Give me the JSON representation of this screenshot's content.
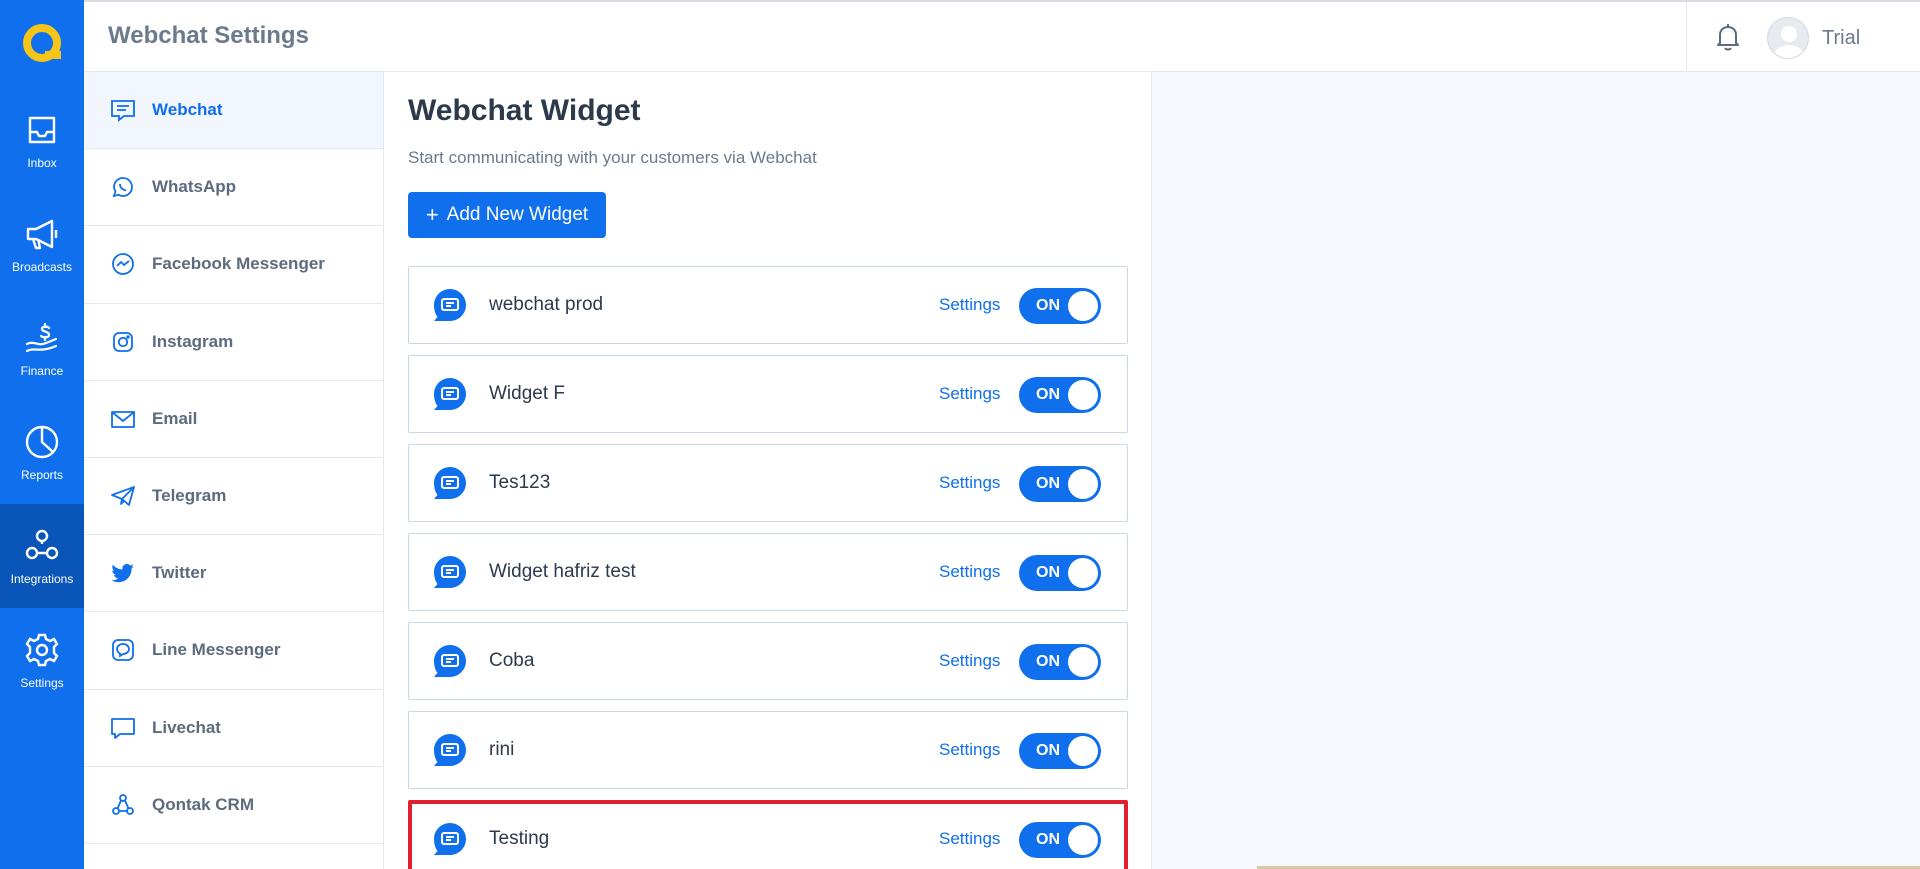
{
  "header": {
    "title": "Webchat Settings",
    "user_name": "Trial"
  },
  "rail": {
    "items": [
      {
        "label": "Inbox",
        "icon": "inbox-icon"
      },
      {
        "label": "Broadcasts",
        "icon": "megaphone-icon"
      },
      {
        "label": "Finance",
        "icon": "finance-icon"
      },
      {
        "label": "Reports",
        "icon": "pie-chart-icon"
      },
      {
        "label": "Integrations",
        "icon": "integrations-icon",
        "active": true
      },
      {
        "label": "Settings",
        "icon": "gear-icon"
      }
    ]
  },
  "subnav": {
    "items": [
      {
        "label": "Webchat",
        "icon": "webchat-icon",
        "active": true
      },
      {
        "label": "WhatsApp",
        "icon": "whatsapp-icon"
      },
      {
        "label": "Facebook Messenger",
        "icon": "messenger-icon"
      },
      {
        "label": "Instagram",
        "icon": "instagram-icon"
      },
      {
        "label": "Email",
        "icon": "email-icon"
      },
      {
        "label": "Telegram",
        "icon": "telegram-icon"
      },
      {
        "label": "Twitter",
        "icon": "twitter-icon"
      },
      {
        "label": "Line Messenger",
        "icon": "line-icon"
      },
      {
        "label": "Livechat",
        "icon": "livechat-icon"
      },
      {
        "label": "Qontak CRM",
        "icon": "crm-icon"
      }
    ]
  },
  "main": {
    "title": "Webchat Widget",
    "description": "Start communicating with your customers via Webchat",
    "add_button_label": "Add New Widget",
    "add_button_icon": "+",
    "settings_label": "Settings",
    "toggle_label": "ON",
    "widgets": [
      {
        "name": "webchat prod",
        "status": "ON"
      },
      {
        "name": "Widget F",
        "status": "ON"
      },
      {
        "name": "Tes123",
        "status": "ON"
      },
      {
        "name": "Widget hafriz test",
        "status": "ON"
      },
      {
        "name": "Coba",
        "status": "ON"
      },
      {
        "name": "rini",
        "status": "ON"
      },
      {
        "name": "Testing",
        "status": "ON",
        "highlighted": true
      }
    ]
  },
  "colors": {
    "primary": "#0f6fec",
    "highlight": "#e0202e",
    "logo": "#f5c518"
  }
}
